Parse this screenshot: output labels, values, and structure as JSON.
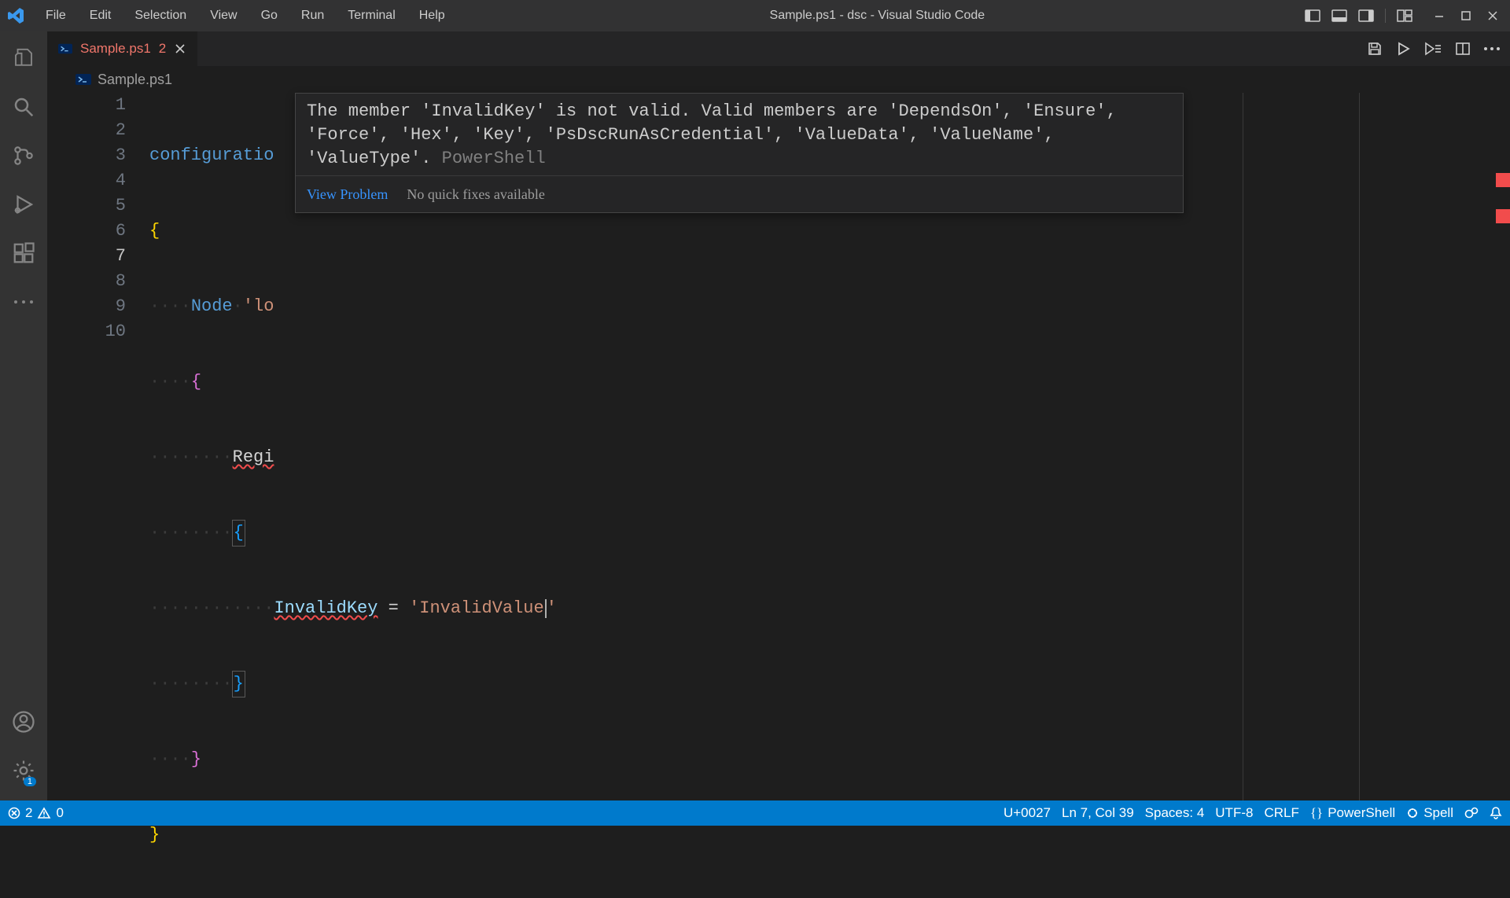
{
  "titlebar": {
    "menu": [
      "File",
      "Edit",
      "Selection",
      "View",
      "Go",
      "Run",
      "Terminal",
      "Help"
    ],
    "title": "Sample.ps1 - dsc - Visual Studio Code"
  },
  "tab": {
    "label": "Sample.ps1",
    "dirty_marker": "2"
  },
  "breadcrumb": {
    "file": "Sample.ps1"
  },
  "editor": {
    "lines": {
      "l1": {
        "num": "1",
        "kw": "configuratio"
      },
      "l2": {
        "num": "2",
        "brace": "{"
      },
      "l3": {
        "num": "3",
        "kw": "Node",
        "str": "'lo"
      },
      "l4": {
        "num": "4",
        "brace": "{"
      },
      "l5": {
        "num": "5",
        "txt": "Regi"
      },
      "l6": {
        "num": "6",
        "brace": "{"
      },
      "l7": {
        "num": "7",
        "member": "InvalidKey",
        "eq": " = ",
        "strq": "'",
        "str": "InvalidValue",
        "strq2": "'"
      },
      "l8": {
        "num": "8",
        "brace": "}"
      },
      "l9": {
        "num": "9",
        "brace": "}"
      },
      "l10": {
        "num": "10",
        "brace": "}"
      }
    }
  },
  "hover": {
    "message": "The member 'InvalidKey' is not valid. Valid members are 'DependsOn', 'Ensure', 'Force', 'Hex', 'Key', 'PsDscRunAsCredential', 'ValueData', 'ValueName', 'ValueType'.",
    "source": " PowerShell",
    "view_problem": "View Problem",
    "no_fix": "No quick fixes available"
  },
  "statusbar": {
    "errors": "2",
    "warnings": "0",
    "codepoint": "U+0027",
    "position": "Ln 7, Col 39",
    "spaces": "Spaces: 4",
    "encoding": "UTF-8",
    "eol": "CRLF",
    "language": "PowerShell",
    "spell": "Spell"
  },
  "activity_badge": "1"
}
